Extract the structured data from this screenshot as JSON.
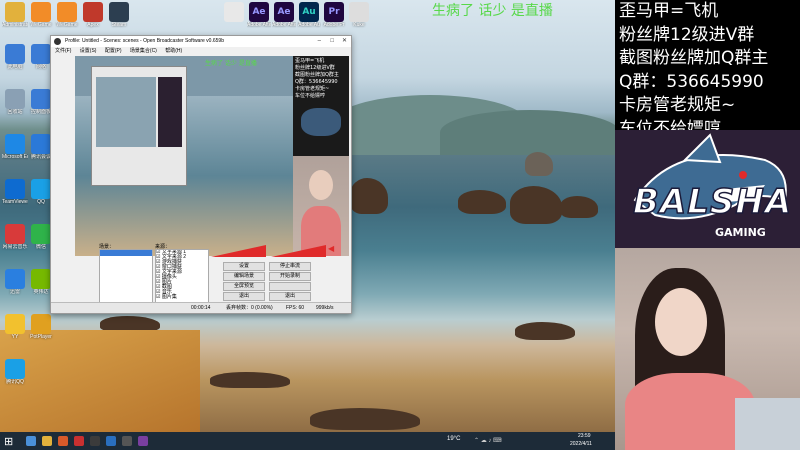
{
  "overlay_text": "生病了 话少 是直播",
  "info_lines": [
    "歪马甲=飞机",
    "粉丝牌12级进V群",
    "截图粉丝牌加Q群主",
    "Q群：536645990",
    "卡房管老规矩~",
    "车位不给嫖哼"
  ],
  "logo": {
    "brand": "BALSHA",
    "sub": "GAMING"
  },
  "colors": {
    "overlay_green": "#58d84a",
    "obs_accent": "#e02a2a",
    "taskbar": "#1d2b38"
  },
  "desktop_icons": [
    {
      "label": "Administrator",
      "icon": "folder-icon"
    },
    {
      "label": "WeGame",
      "icon": "wegame-icon"
    },
    {
      "label": "WeGame",
      "icon": "wegame-icon"
    },
    {
      "label": "Apex",
      "icon": "game-icon"
    },
    {
      "label": "Steam",
      "icon": "steam-icon"
    },
    {
      "label": "此电脑",
      "icon": "computer-icon"
    },
    {
      "label": "网络",
      "icon": "network-icon"
    },
    {
      "label": "回收站",
      "icon": "recycle-bin-icon"
    },
    {
      "label": "控制面板",
      "icon": "control-panel-icon"
    },
    {
      "label": "Microsoft Edge",
      "icon": "edge-icon"
    },
    {
      "label": "腾讯会议",
      "icon": "meeting-icon"
    },
    {
      "label": "TeamViewer",
      "icon": "teamviewer-icon"
    },
    {
      "label": "QQ",
      "icon": "qq-icon"
    },
    {
      "label": "网易云音乐",
      "icon": "music-icon"
    },
    {
      "label": "微信",
      "icon": "wechat-icon"
    },
    {
      "label": "迅雷",
      "icon": "thunder-icon"
    },
    {
      "label": "英伟达",
      "icon": "nvidia-icon"
    },
    {
      "label": "YY",
      "icon": "yy-icon"
    },
    {
      "label": "PotPlayer",
      "icon": "player-icon"
    },
    {
      "label": "腾讯QQ",
      "icon": "qq-icon"
    }
  ],
  "top_apps": [
    {
      "label": "",
      "icon": "file-icon"
    },
    {
      "label": "Adobe After",
      "glyph": "Ae",
      "icon": "ae-icon"
    },
    {
      "label": "Adobe After",
      "glyph": "Ae",
      "icon": "ae-icon"
    },
    {
      "label": "Adobe Au",
      "glyph": "Au",
      "icon": "au-icon"
    },
    {
      "label": "Adobe Pr",
      "glyph": "Pr",
      "icon": "pr-icon"
    },
    {
      "label": "Kuke",
      "icon": "kuke-icon"
    }
  ],
  "obs": {
    "title": "Profile: Untitled - Scenes: scenes - Open Broadcaster Software v0.659b",
    "menu": [
      "文件(F)",
      "设置(S)",
      "配置(P)",
      "场景集合(C)",
      "帮助(H)"
    ],
    "scenes_label": "场景：",
    "sources_label": "来源：",
    "sources": [
      "文字来源 1",
      "文字来源 2",
      "游戏捕获",
      "窗口捕获",
      "文字来源",
      "摄像头",
      "图片",
      "截图",
      "音乐",
      "图片集"
    ],
    "buttons": [
      "设置",
      "停止串流",
      "编辑场景",
      "开始录制",
      "全屏预览",
      "",
      "退出",
      "退出"
    ],
    "status": [
      "00:00:14",
      "丢弃帧数：0 (0.00%)",
      "FPS: 60",
      "999kb/s"
    ]
  },
  "taskbar": {
    "weather": "19°C",
    "time": "23:59",
    "date": "2022/4/11"
  }
}
